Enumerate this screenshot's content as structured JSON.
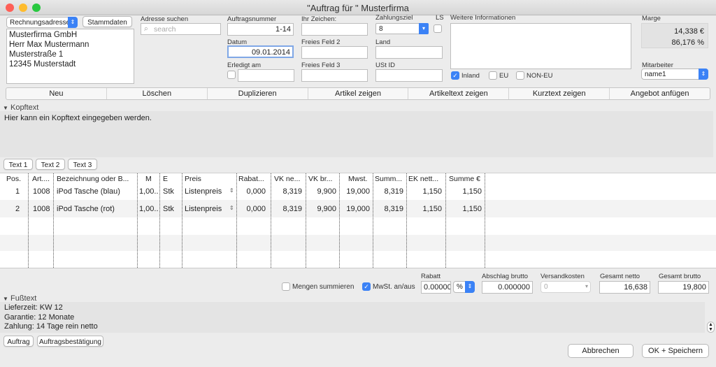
{
  "window": {
    "title": "\"Auftrag für \" Musterfirma"
  },
  "address": {
    "type_select": "Rechnungsadresse",
    "stammdaten_btn": "Stammdaten",
    "lines": [
      "Musterfirma GmbH",
      "Herr Max Mustermann",
      "Musterstraße 1",
      "12345 Musterstadt"
    ]
  },
  "search": {
    "label": "Adresse suchen",
    "placeholder": "search"
  },
  "order": {
    "nr_label": "Auftragsnummer",
    "nr_value": "1-14",
    "date_label": "Datum",
    "date_value": "09.01.2014",
    "done_label": "Erledigt am"
  },
  "refs": {
    "ihr_zeichen_label": "Ihr Zeichen:",
    "freies2_label": "Freies Feld 2",
    "freies3_label": "Freies Feld 3"
  },
  "payment": {
    "ziel_label": "Zahlungsziel",
    "ziel_value": "8",
    "ls_label": "LS",
    "land_label": "Land",
    "ust_label": "USt ID"
  },
  "info": {
    "label": "Weitere Informationen",
    "inland": "Inland",
    "eu": "EU",
    "non_eu": "NON-EU"
  },
  "marge": {
    "label": "Marge",
    "abs": "14,338 €",
    "pct": "86,176 %"
  },
  "mitarbeiter": {
    "label": "Mitarbeiter",
    "value": "name1"
  },
  "toolbar": [
    "Neu",
    "Löschen",
    "Duplizieren",
    "Artikel zeigen",
    "Artikeltext zeigen",
    "Kurztext zeigen",
    "Angebot anfügen"
  ],
  "kopf": {
    "label": "Kopftext",
    "text": "Hier kann ein Kopftext eingegeben werden.",
    "btns": [
      "Text 1",
      "Text 2",
      "Text 3"
    ]
  },
  "table": {
    "headers": [
      "Pos.",
      "Art....",
      "Bezeichnung oder B...",
      "M",
      "E",
      "Preis",
      "Rabat...",
      "VK ne...",
      "VK br...",
      "Mwst.",
      "Summ...",
      "EK nett...",
      "Summe €"
    ],
    "rows": [
      [
        "1",
        "1008",
        "iPod Tasche  (blau)",
        "1,00...",
        "Stk",
        "Listenpreis",
        "0,000",
        "8,319",
        "9,900",
        "19,000",
        "8,319",
        "1,150",
        "1,150"
      ],
      [
        "2",
        "1008",
        "iPod Tasche  (rot)",
        "1,00...",
        "Stk",
        "Listenpreis",
        "0,000",
        "8,319",
        "9,900",
        "19,000",
        "8,319",
        "1,150",
        "1,150"
      ]
    ]
  },
  "totals": {
    "mengen": "Mengen summieren",
    "mwst": "MwSt. an/aus",
    "rabatt_label": "Rabatt",
    "rabatt_value": "0.00000",
    "rabatt_unit": "%",
    "abschlag_label": "Abschlag brutto",
    "abschlag_value": "0.000000",
    "versand_label": "Versandkosten",
    "versand_value": "0",
    "netto_label": "Gesamt netto",
    "netto_value": "16,638",
    "brutto_label": "Gesamt brutto",
    "brutto_value": "19,800"
  },
  "fuss": {
    "label": "Fußtext",
    "lines": [
      "Lieferzeit: KW 12",
      "Garantie: 12 Monate",
      "Zahlung: 14 Tage rein netto"
    ],
    "btns": [
      "Auftrag",
      "Auftragsbestätigung"
    ]
  },
  "actions": {
    "cancel": "Abbrechen",
    "save": "OK + Speichern"
  }
}
